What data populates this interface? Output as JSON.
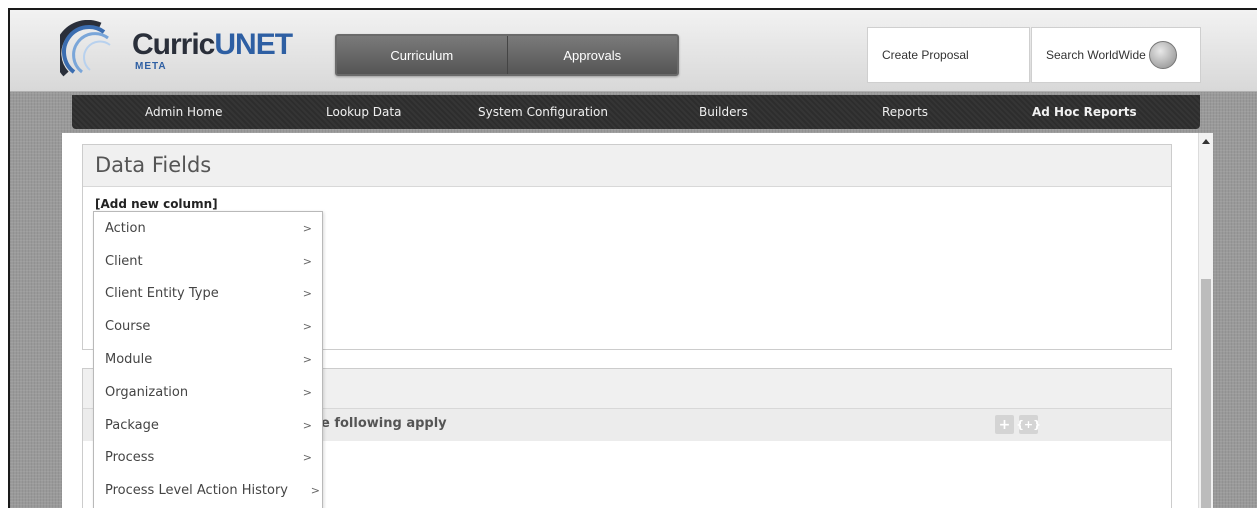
{
  "app": {
    "logo_text_main": "Curric",
    "logo_text_accent": "UNET",
    "logo_sub": "META"
  },
  "main_nav": [
    "Curriculum",
    "Approvals"
  ],
  "header_buttons": {
    "create": "Create Proposal",
    "search": "Search WorldWide"
  },
  "admin_nav": [
    {
      "label": "Admin Home"
    },
    {
      "label": "Lookup Data"
    },
    {
      "label": "System Configuration"
    },
    {
      "label": "Builders"
    },
    {
      "label": "Reports"
    },
    {
      "label": "Ad Hoc Reports",
      "active": true
    }
  ],
  "data_fields": {
    "title": "Data Fields",
    "add_column": "[Add new column]"
  },
  "filter": {
    "row_text": "e following apply"
  },
  "menu": {
    "items": [
      {
        "label": "Action",
        "arrow": ">"
      },
      {
        "label": "Client",
        "arrow": ">"
      },
      {
        "label": "Client Entity Type",
        "arrow": ">"
      },
      {
        "label": "Course",
        "arrow": ">"
      },
      {
        "label": "Module",
        "arrow": ">"
      },
      {
        "label": "Organization",
        "arrow": ">"
      },
      {
        "label": "Package",
        "arrow": ">"
      },
      {
        "label": "Process",
        "arrow": ">"
      },
      {
        "label": "Process Level Action History",
        "arrow": ">"
      }
    ]
  },
  "icons": {
    "plus": "+",
    "group": "{+}"
  }
}
